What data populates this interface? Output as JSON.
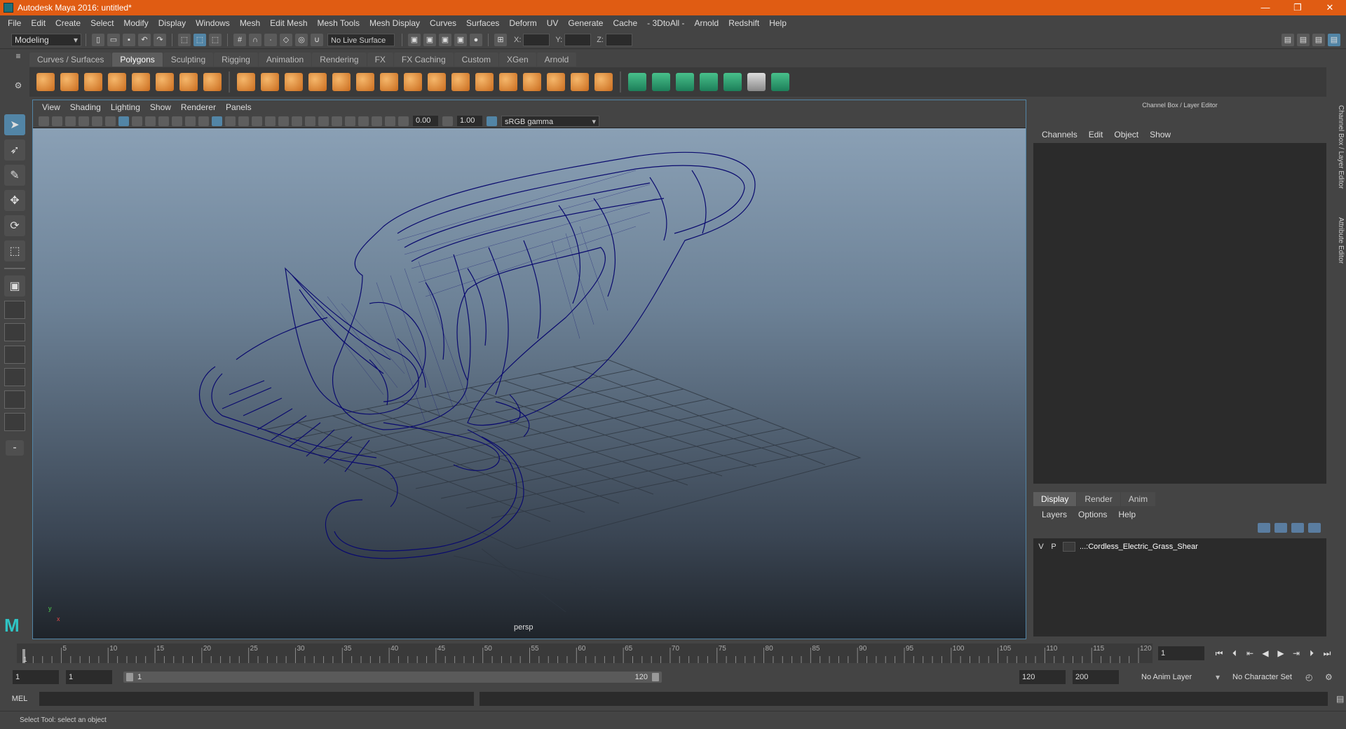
{
  "window": {
    "title": "Autodesk Maya 2016: untitled*",
    "controls": [
      "—",
      "❐",
      "✕"
    ]
  },
  "menubar": [
    "File",
    "Edit",
    "Create",
    "Select",
    "Modify",
    "Display",
    "Windows",
    "Mesh",
    "Edit Mesh",
    "Mesh Tools",
    "Mesh Display",
    "Curves",
    "Surfaces",
    "Deform",
    "UV",
    "Generate",
    "Cache",
    "- 3DtoAll -",
    "Arnold",
    "Redshift",
    "Help"
  ],
  "statusline": {
    "mode": "Modeling",
    "live_surface": "No Live Surface",
    "x_label": "X:",
    "y_label": "Y:",
    "z_label": "Z:"
  },
  "shelf": {
    "tabs": [
      "Curves / Surfaces",
      "Polygons",
      "Sculpting",
      "Rigging",
      "Animation",
      "Rendering",
      "FX",
      "FX Caching",
      "Custom",
      "XGen",
      "Arnold"
    ],
    "active_tab": "Polygons"
  },
  "viewport": {
    "menu": [
      "View",
      "Shading",
      "Lighting",
      "Show",
      "Renderer",
      "Panels"
    ],
    "exposure": "0.00",
    "gamma": "1.00",
    "color_space": "sRGB gamma",
    "camera_label": "persp",
    "axis_x": "x",
    "axis_y": "y"
  },
  "channel_box": {
    "title": "Channel Box / Layer Editor",
    "menu": [
      "Channels",
      "Edit",
      "Object",
      "Show"
    ],
    "side_tabs": [
      "Channel Box / Layer Editor",
      "Attribute Editor"
    ]
  },
  "layer_editor": {
    "tabs": [
      "Display",
      "Render",
      "Anim"
    ],
    "menu": [
      "Layers",
      "Options",
      "Help"
    ],
    "layers": [
      {
        "v": "V",
        "p": "P",
        "name": "...:Cordless_Electric_Grass_Shear"
      }
    ]
  },
  "timeline": {
    "start": 1,
    "end": 120,
    "ticks": [
      5,
      10,
      15,
      20,
      25,
      30,
      35,
      40,
      45,
      50,
      55,
      60,
      65,
      70,
      75,
      80,
      85,
      90,
      95,
      100,
      105,
      110,
      115,
      120
    ],
    "start_label": "1",
    "current_frame": "1"
  },
  "range": {
    "start_field": "1",
    "playback_start": "1",
    "slider_start": "1",
    "slider_end": "120",
    "playback_end": "120",
    "end_field": "200",
    "anim_layer": "No Anim Layer",
    "character_set": "No Character Set"
  },
  "cmdline": {
    "label": "MEL"
  },
  "helpline": {
    "text": "Select Tool: select an object"
  },
  "colors": {
    "title_bar": "#e05c13",
    "accent": "#5285a6",
    "wireframe": "#0a0a6e"
  }
}
